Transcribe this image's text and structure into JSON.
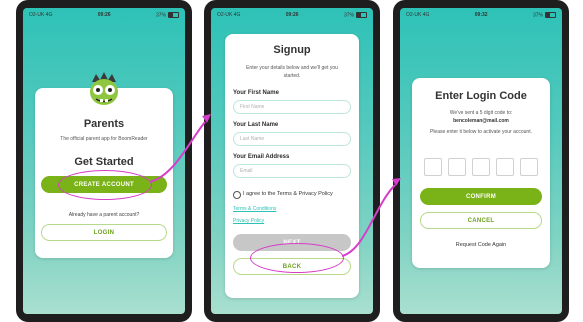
{
  "colors": {
    "teal": "#2ec2b7",
    "green": "#7ab317",
    "magenta": "#d63ec9"
  },
  "status": {
    "screen1": {
      "carrier": "O2-UK 4G",
      "time": "09:26",
      "battery": "37%"
    },
    "screen2": {
      "carrier": "O2-UK 4G",
      "time": "09:26",
      "battery": "37%"
    },
    "screen3": {
      "carrier": "O2-UK 4G",
      "time": "09:32",
      "battery": "37%"
    }
  },
  "screen1": {
    "mascot_icon": "green-zombie-mascot-icon",
    "title": "Parents",
    "subtitle": "The official parent app for BoomReader",
    "get_started": "Get Started",
    "create_account": "CREATE ACCOUNT",
    "have_account": "Already have a parent account?",
    "login": "LOGIN"
  },
  "screen2": {
    "title": "Signup",
    "subtitle": "Enter your details below and we'll get you started.",
    "first_name_label": "Your First Name",
    "first_name_placeholder": "First Name",
    "last_name_label": "Your Last Name",
    "last_name_placeholder": "Last Name",
    "email_label": "Your Email Address",
    "email_placeholder": "Email",
    "agree": "I agree to the Terms & Privacy Policy",
    "terms": "Terms & Conditions",
    "privacy": "Privacy Policy",
    "next": "NEXT",
    "back": "BACK"
  },
  "screen3": {
    "title": "Enter Login Code",
    "sent_line": "We've sent a 5 digit code to:",
    "email": "bencoleman@mail.com",
    "instructions": "Please enter it below to activate your account.",
    "confirm": "CONFIRM",
    "cancel": "CANCEL",
    "request_again": "Request Code Again"
  }
}
